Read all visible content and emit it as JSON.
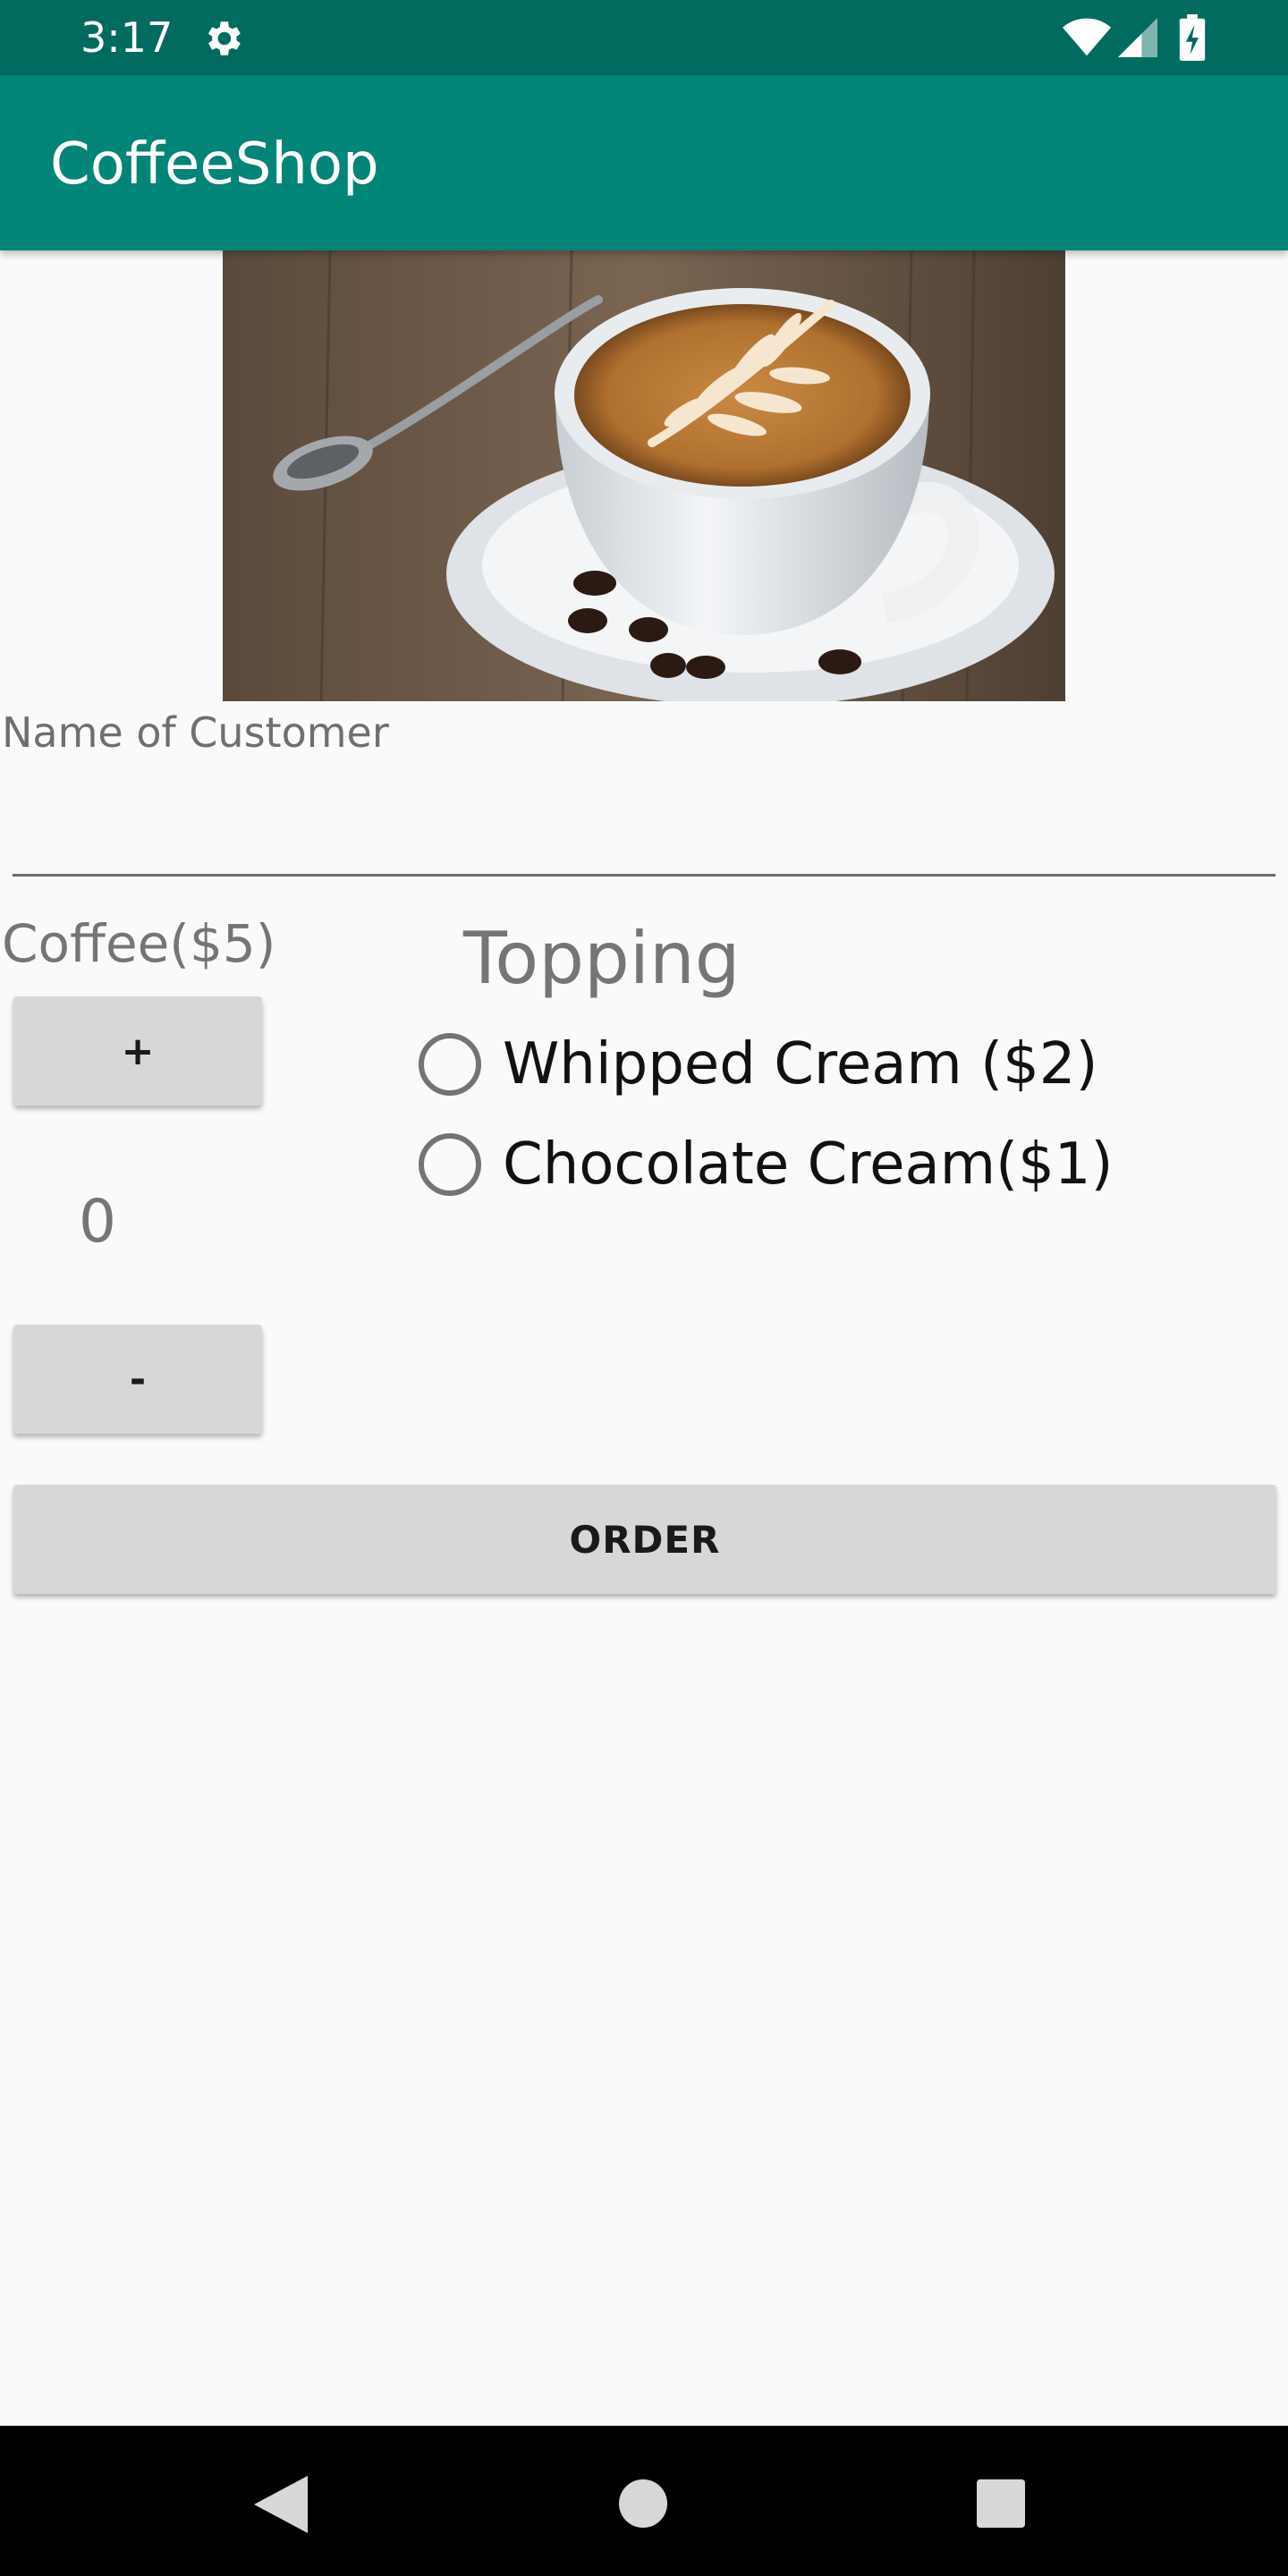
{
  "status_bar": {
    "time": "3:17",
    "icons": [
      "gear-icon",
      "wifi-icon",
      "signal-icon",
      "battery-charging-icon"
    ]
  },
  "app_bar": {
    "title": "CoffeeShop"
  },
  "hero": {
    "icon": "coffee-cup-photo"
  },
  "customer": {
    "label": "Name of Customer",
    "value": "",
    "placeholder": ""
  },
  "coffee": {
    "label": "Coffee($5)",
    "plus_label": "+",
    "quantity": "0",
    "minus_label": "-"
  },
  "topping": {
    "title": "Topping",
    "options": [
      {
        "label": "Whipped Cream ($2)",
        "checked": false
      },
      {
        "label": "Chocolate Cream($1)",
        "checked": false
      }
    ]
  },
  "order": {
    "label": "ORDER"
  },
  "nav_bar": {
    "icons": [
      "back-icon",
      "home-icon",
      "recent-apps-icon"
    ]
  },
  "colors": {
    "status_bar": "#016b5f",
    "app_bar": "#018577",
    "background": "#fafafa",
    "button": "#d6d7d7"
  }
}
